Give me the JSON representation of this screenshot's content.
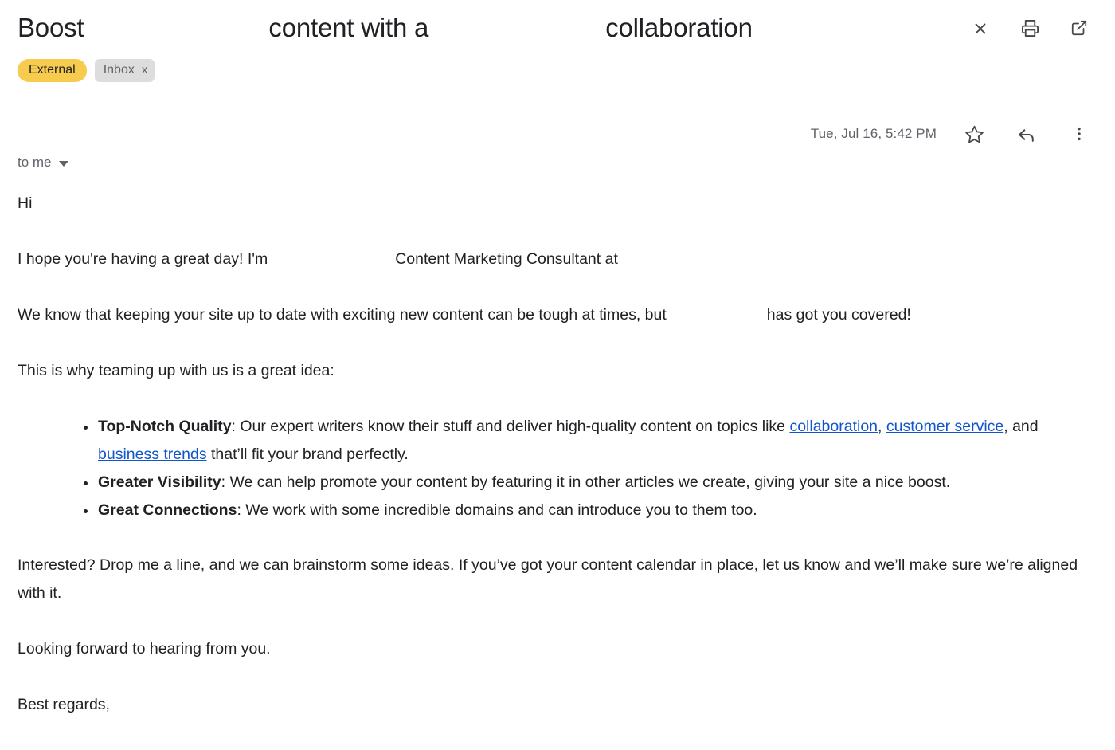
{
  "header": {
    "subject_part1": "Boost",
    "subject_part2": "content with a",
    "subject_part3": "collaboration",
    "actions": [
      {
        "name": "collapse-all-icon",
        "label": "Collapse all"
      },
      {
        "name": "print-icon",
        "label": "Print all"
      },
      {
        "name": "open-in-new-icon",
        "label": "Open in new window"
      }
    ]
  },
  "labels": {
    "external": "External",
    "inbox": "Inbox",
    "remove_label": "x"
  },
  "meta": {
    "date": "Tue, Jul 16, 5:42 PM",
    "actions": [
      {
        "name": "star-icon",
        "label": "Star"
      },
      {
        "name": "reply-icon",
        "label": "Reply"
      },
      {
        "name": "more-options-icon",
        "label": "More"
      }
    ]
  },
  "recipients": {
    "to_label": "to me"
  },
  "body": {
    "greeting": "Hi",
    "intro_before": "I hope you're having a great day! I'm",
    "intro_after": "Content Marketing Consultant at",
    "para_know_before": "We know that keeping your site up to date with exciting new content can be tough at times, but",
    "para_know_after": "has got you covered!",
    "para_why": "This is why teaming up with us is a great idea:",
    "bullets": [
      {
        "title": "Top-Notch Quality",
        "text_before": ": Our expert writers know their stuff and deliver high-quality content on topics like ",
        "link1": "collaboration",
        "text_mid1": ", ",
        "link2": "customer service",
        "text_mid2": ", and ",
        "link3": "business trends",
        "text_after": " that’ll fit your brand perfectly."
      },
      {
        "title": "Greater Visibility",
        "text_before": ": We can help promote your content by featuring it in other articles we create, giving your site a nice boost."
      },
      {
        "title": "Great Connections",
        "text_before": ": We work with some incredible domains and can introduce you to them too."
      }
    ],
    "para_interested": "Interested? Drop me a line, and we can brainstorm some ideas. If you’ve got your content calendar in place, let us know and we’ll make sure we’re aligned with it.",
    "para_looking": "Looking forward to hearing from you.",
    "para_regards": "Best regards,"
  },
  "colors": {
    "external_badge": "#f7cb4d",
    "inbox_chip": "#dddddd",
    "link": "#1155cc",
    "text": "#202124",
    "muted": "#5f6368"
  }
}
